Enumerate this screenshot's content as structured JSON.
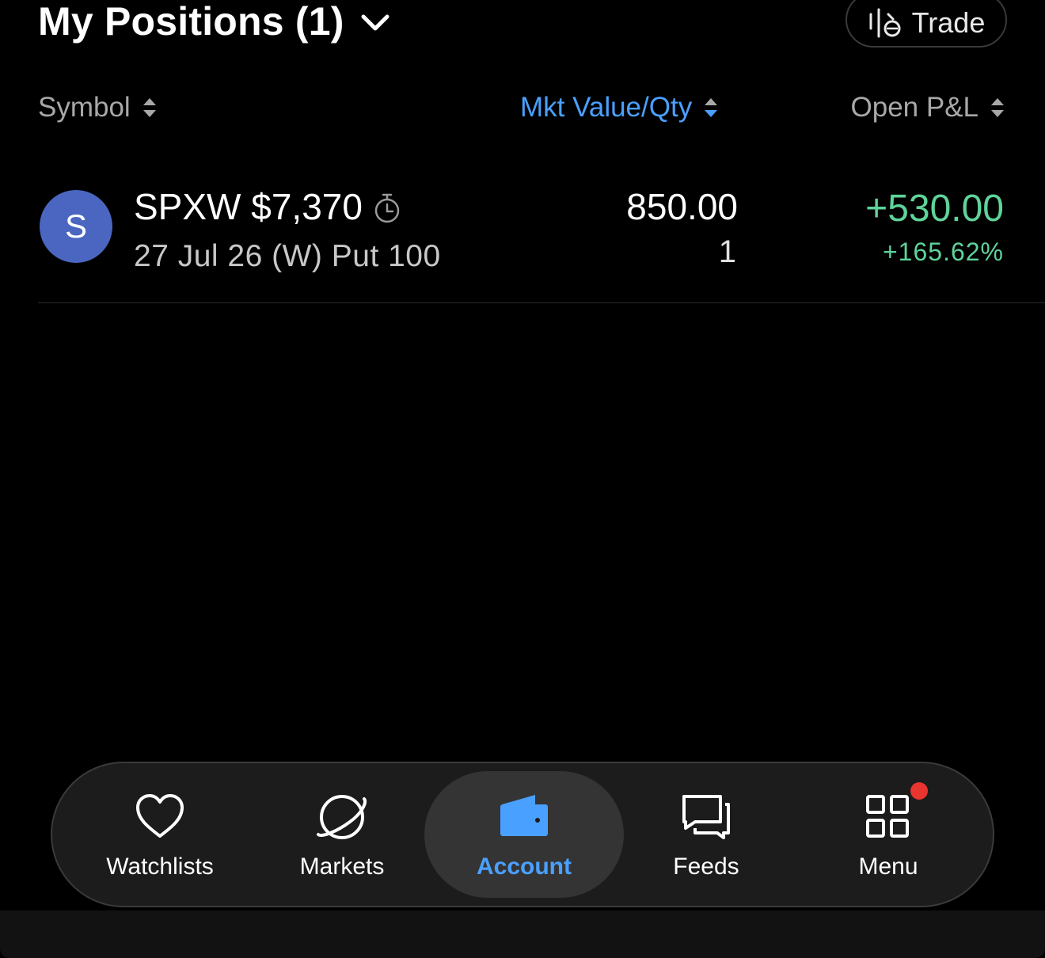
{
  "header": {
    "title": "My Positions (1)",
    "trade_label": "Trade"
  },
  "columns": {
    "symbol": "Symbol",
    "mkt_value_qty": "Mkt Value/Qty",
    "open_pnl": "Open P&L"
  },
  "positions": [
    {
      "avatar_letter": "S",
      "symbol_line": "SPXW $7,370",
      "contract_line": "27 Jul 26 (W) Put 100",
      "mkt_value": "850.00",
      "qty": "1",
      "open_pnl": "+530.00",
      "open_pnl_pct": "+165.62%"
    }
  ],
  "nav": {
    "watchlists": "Watchlists",
    "markets": "Markets",
    "account": "Account",
    "feeds": "Feeds",
    "menu": "Menu"
  },
  "colors": {
    "accent": "#4aa0ff",
    "positive": "#5fd39a",
    "avatar": "#4a66c0",
    "notification": "#e8352f"
  }
}
